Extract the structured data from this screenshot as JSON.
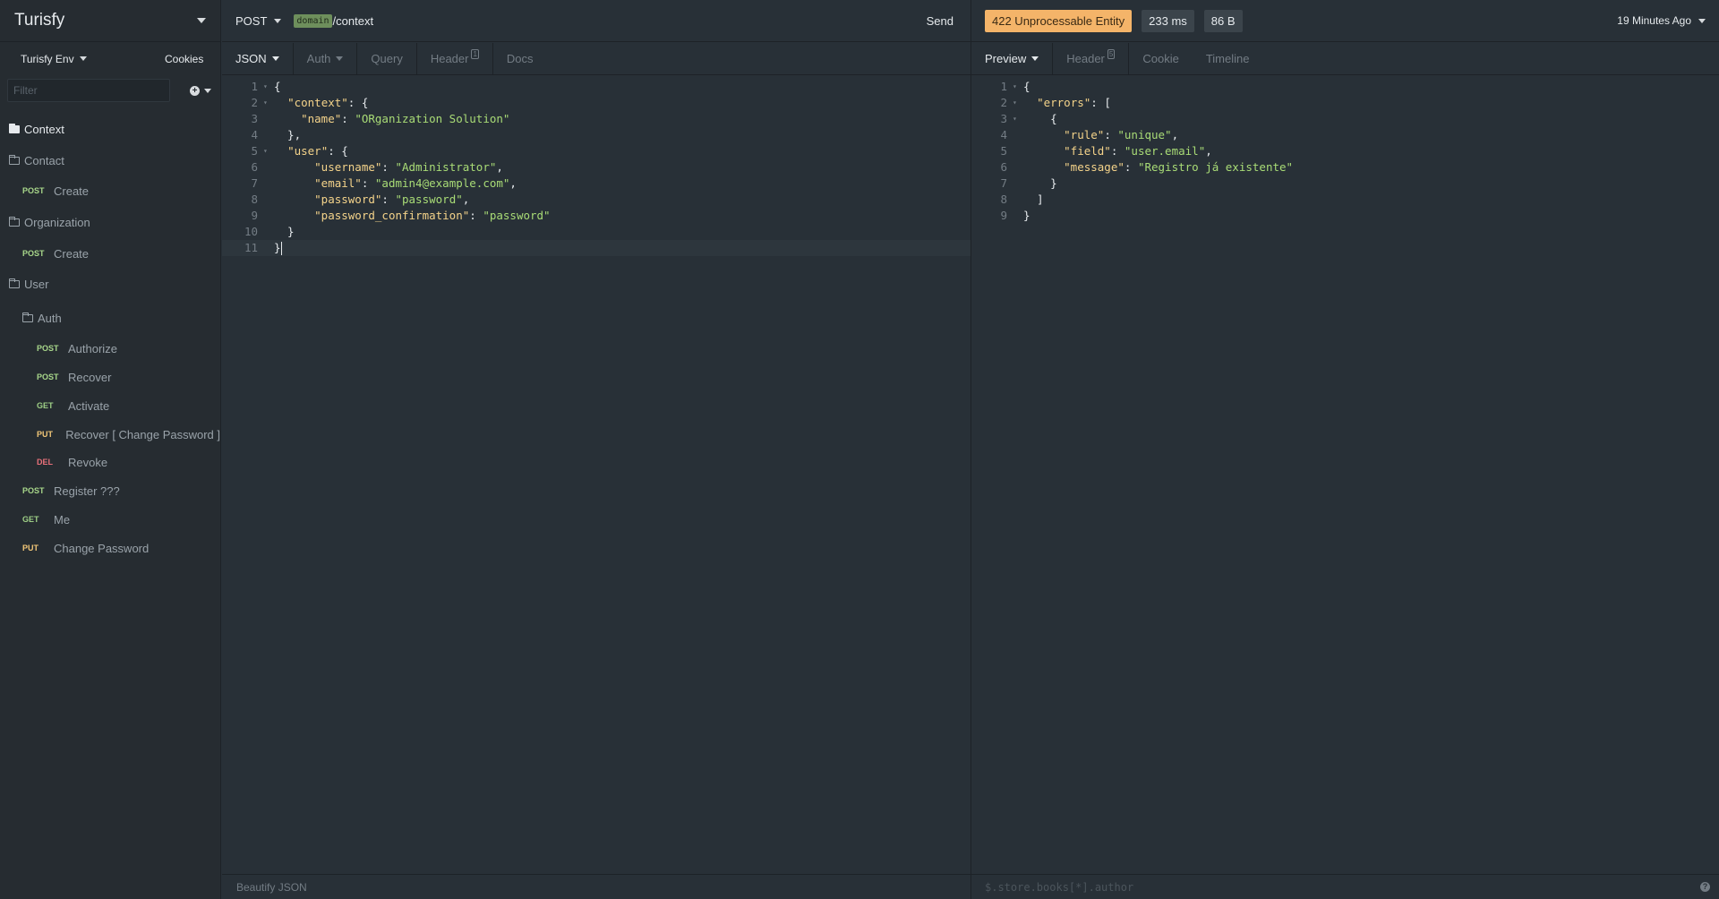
{
  "sidebar": {
    "title": "Turisfy",
    "env_label": "Turisfy Env",
    "cookies_label": "Cookies",
    "filter_placeholder": "Filter",
    "tree": [
      {
        "kind": "folder-open",
        "label": "Context"
      },
      {
        "kind": "folder",
        "label": "Contact"
      },
      {
        "kind": "request",
        "method": "POST",
        "label": "Create"
      },
      {
        "kind": "folder",
        "label": "Organization"
      },
      {
        "kind": "request",
        "method": "POST",
        "label": "Create"
      },
      {
        "kind": "folder",
        "label": "User"
      },
      {
        "kind": "folder",
        "label": "Auth"
      },
      {
        "kind": "request",
        "method": "POST",
        "label": "Authorize"
      },
      {
        "kind": "request",
        "method": "POST",
        "label": "Recover"
      },
      {
        "kind": "request",
        "method": "GET",
        "label": "Activate"
      },
      {
        "kind": "request",
        "method": "PUT",
        "label": "Recover [ Change Password ]"
      },
      {
        "kind": "request",
        "method": "DEL",
        "label": "Revoke"
      },
      {
        "kind": "request",
        "method": "POST",
        "label": "Register ???"
      },
      {
        "kind": "request",
        "method": "GET",
        "label": "Me"
      },
      {
        "kind": "request",
        "method": "PUT",
        "label": "Change Password"
      }
    ]
  },
  "request": {
    "method": "POST",
    "env_tag": "domain",
    "path": "/context",
    "send_label": "Send",
    "tabs": [
      {
        "label": "JSON",
        "active": true,
        "caret": true
      },
      {
        "label": "Auth",
        "active": false,
        "caret": true
      },
      {
        "label": "Query",
        "active": false
      },
      {
        "label": "Header",
        "active": false,
        "count": "1"
      },
      {
        "label": "Docs",
        "active": false
      }
    ],
    "body_lines": [
      "{",
      "  \"context\": {",
      "    \"name\": \"ORganization Solution\"",
      "  },",
      "  \"user\": {",
      "      \"username\": \"Administrator\",",
      "      \"email\": \"admin4@example.com\",",
      "      \"password\": \"password\",",
      "      \"password_confirmation\": \"password\"",
      "  }",
      "}"
    ],
    "beautify_label": "Beautify JSON"
  },
  "response": {
    "status": "422 Unprocessable Entity",
    "time": "233 ms",
    "size": "86 B",
    "time_ago": "19 Minutes Ago",
    "tabs": [
      {
        "label": "Preview",
        "active": true,
        "caret": true
      },
      {
        "label": "Header",
        "active": false,
        "count": "5"
      },
      {
        "label": "Cookie",
        "active": false
      },
      {
        "label": "Timeline",
        "active": false
      }
    ],
    "body_lines": [
      "{",
      "  \"errors\": [",
      "    {",
      "      \"rule\": \"unique\",",
      "      \"field\": \"user.email\",",
      "      \"message\": \"Registro já existente\"",
      "    }",
      "  ]",
      "}"
    ],
    "filter_placeholder": "$.store.books[*].author"
  },
  "colors": {
    "status_badge": "#f4b469",
    "post": "#a8d78a",
    "put": "#f2c778",
    "del": "#e8707a",
    "json_key": "#f4d38a",
    "json_string": "#a9dc76"
  }
}
